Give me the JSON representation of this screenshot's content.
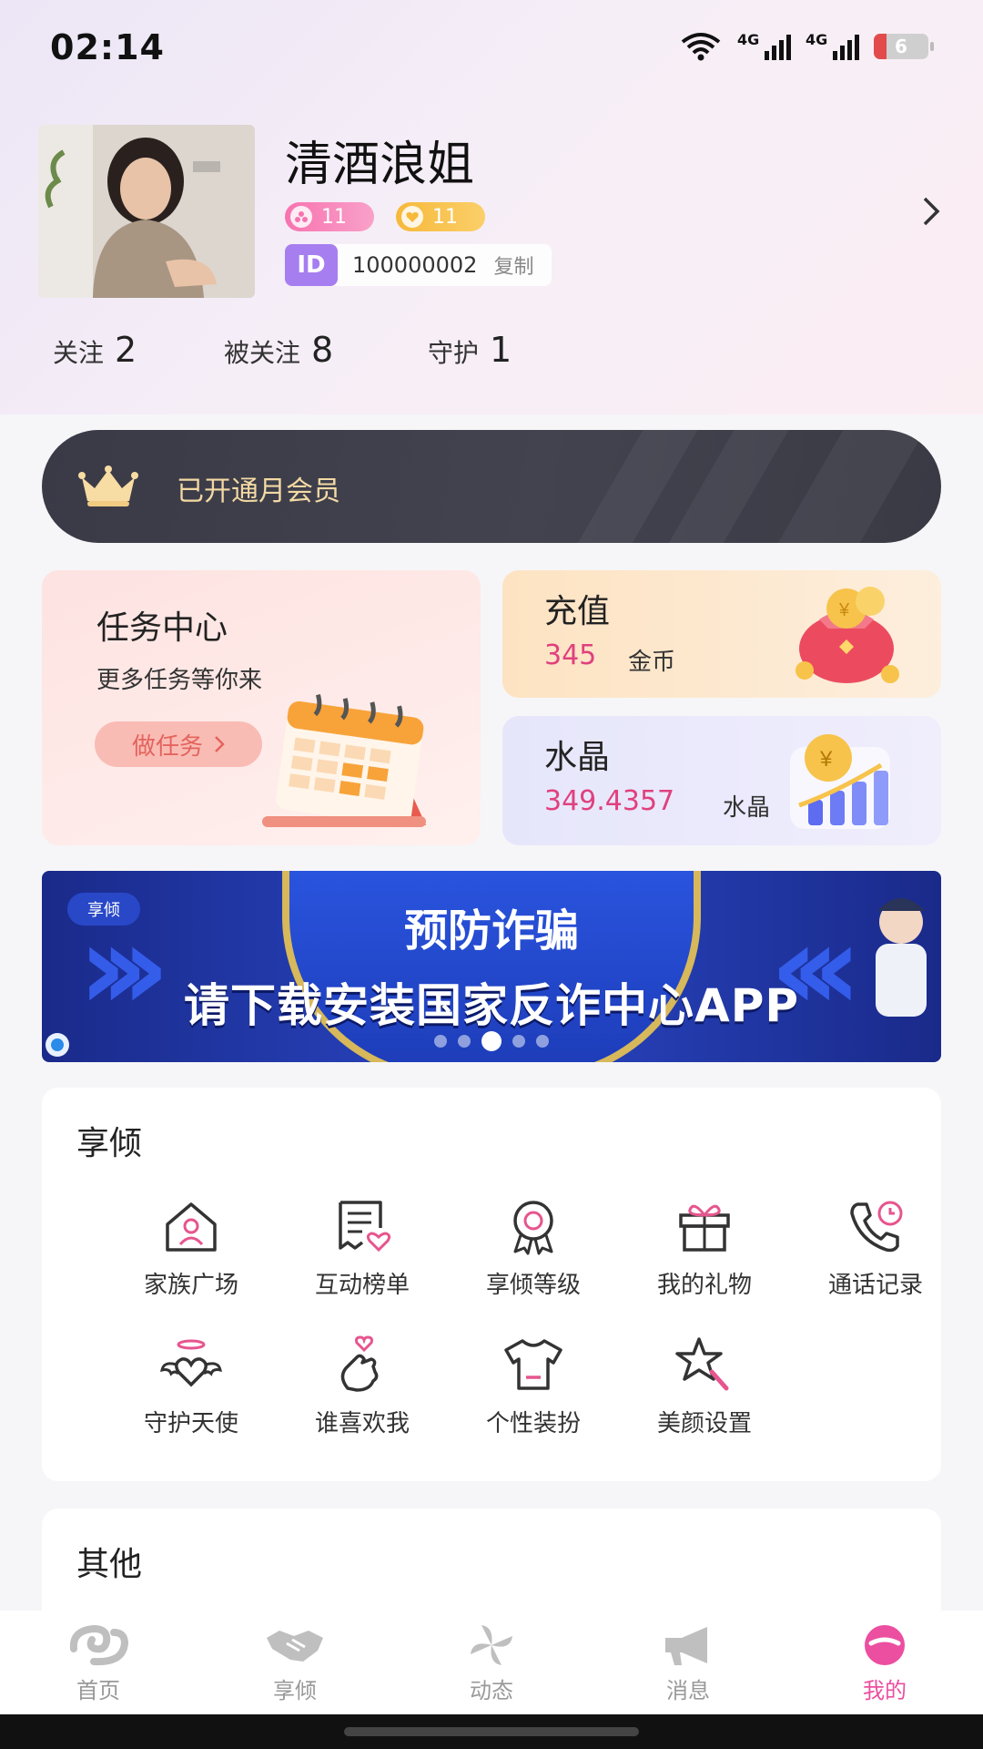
{
  "status_bar": {
    "time": "02:14",
    "network_1": "4G",
    "network_2": "4G",
    "battery": "6"
  },
  "profile": {
    "name": "清酒浪姐",
    "badge_a_level": "11",
    "badge_b_level": "11",
    "id_tag": "ID",
    "id_number": "100000002",
    "copy_label": "复制"
  },
  "stats": [
    {
      "label": "关注",
      "value": "2"
    },
    {
      "label": "被关注",
      "value": "8"
    },
    {
      "label": "守护",
      "value": "1"
    }
  ],
  "vip": {
    "text": "已开通月会员"
  },
  "task_card": {
    "title": "任务中心",
    "subtitle": "更多任务等你来",
    "button": "做任务"
  },
  "recharge_card": {
    "title": "充值",
    "value": "345",
    "unit": "金币"
  },
  "crystal_card": {
    "title": "水晶",
    "value": "349.4357",
    "unit": "水晶"
  },
  "promo": {
    "tag": "享倾",
    "title": "预防诈骗",
    "subtitle": "请下载安装国家反诈中心APP",
    "pages": 5,
    "active_page": 3
  },
  "section_main": {
    "title": "享倾",
    "items": [
      {
        "label": "家族广场",
        "icon": "house-user-icon"
      },
      {
        "label": "互动榜单",
        "icon": "list-heart-icon"
      },
      {
        "label": "享倾等级",
        "icon": "medal-icon"
      },
      {
        "label": "我的礼物",
        "icon": "gift-icon"
      },
      {
        "label": "通话记录",
        "icon": "phone-clock-icon"
      },
      {
        "label": "守护天使",
        "icon": "winged-heart-icon"
      },
      {
        "label": "谁喜欢我",
        "icon": "finger-heart-icon"
      },
      {
        "label": "个性装扮",
        "icon": "tshirt-icon"
      },
      {
        "label": "美颜设置",
        "icon": "magic-star-icon"
      }
    ]
  },
  "section_other": {
    "title": "其他"
  },
  "bottom_nav": [
    {
      "label": "首页",
      "icon": "home-logo-icon"
    },
    {
      "label": "享倾",
      "icon": "handshake-icon"
    },
    {
      "label": "动态",
      "icon": "pinwheel-icon"
    },
    {
      "label": "消息",
      "icon": "megaphone-icon"
    },
    {
      "label": "我的",
      "icon": "me-icon",
      "active": true
    }
  ],
  "colors": {
    "accent_pink": "#ec4ea0",
    "value_pink": "#e0417e",
    "vip_gold": "#f3d9a3",
    "id_purple": "#a77ef0"
  }
}
